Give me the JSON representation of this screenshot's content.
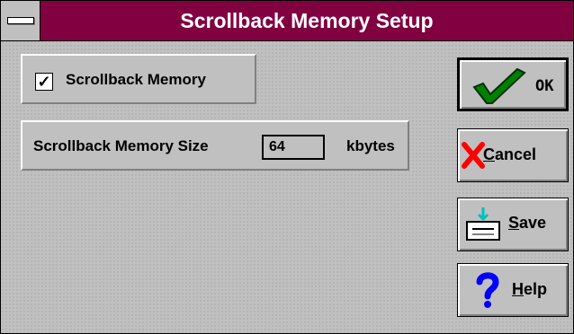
{
  "dialog": {
    "title": "Scrollback Memory Setup"
  },
  "scrollback": {
    "checkbox_label": "Scrollback Memory",
    "checked_mark": "✓",
    "size_label": "Scrollback Memory Size",
    "size_value": "64",
    "size_unit": "kbytes"
  },
  "buttons": {
    "ok": {
      "label": "OK",
      "icon": "checkmark-icon"
    },
    "cancel": {
      "label": "Cancel",
      "label_first": "C",
      "label_rest": "ancel",
      "icon": "red-x-icon"
    },
    "save": {
      "label": "Save",
      "label_first": "S",
      "label_rest": "ave",
      "icon": "save-drive-icon"
    },
    "help": {
      "label": "Help",
      "label_first": "H",
      "label_rest": "elp",
      "icon": "question-icon"
    }
  },
  "colors": {
    "titlebar": "#800040",
    "face": "#c0c0c0",
    "check_green": "#008000",
    "cancel_red": "#ff0000",
    "help_blue": "#0000ff",
    "save_cyan": "#00c0c0"
  }
}
